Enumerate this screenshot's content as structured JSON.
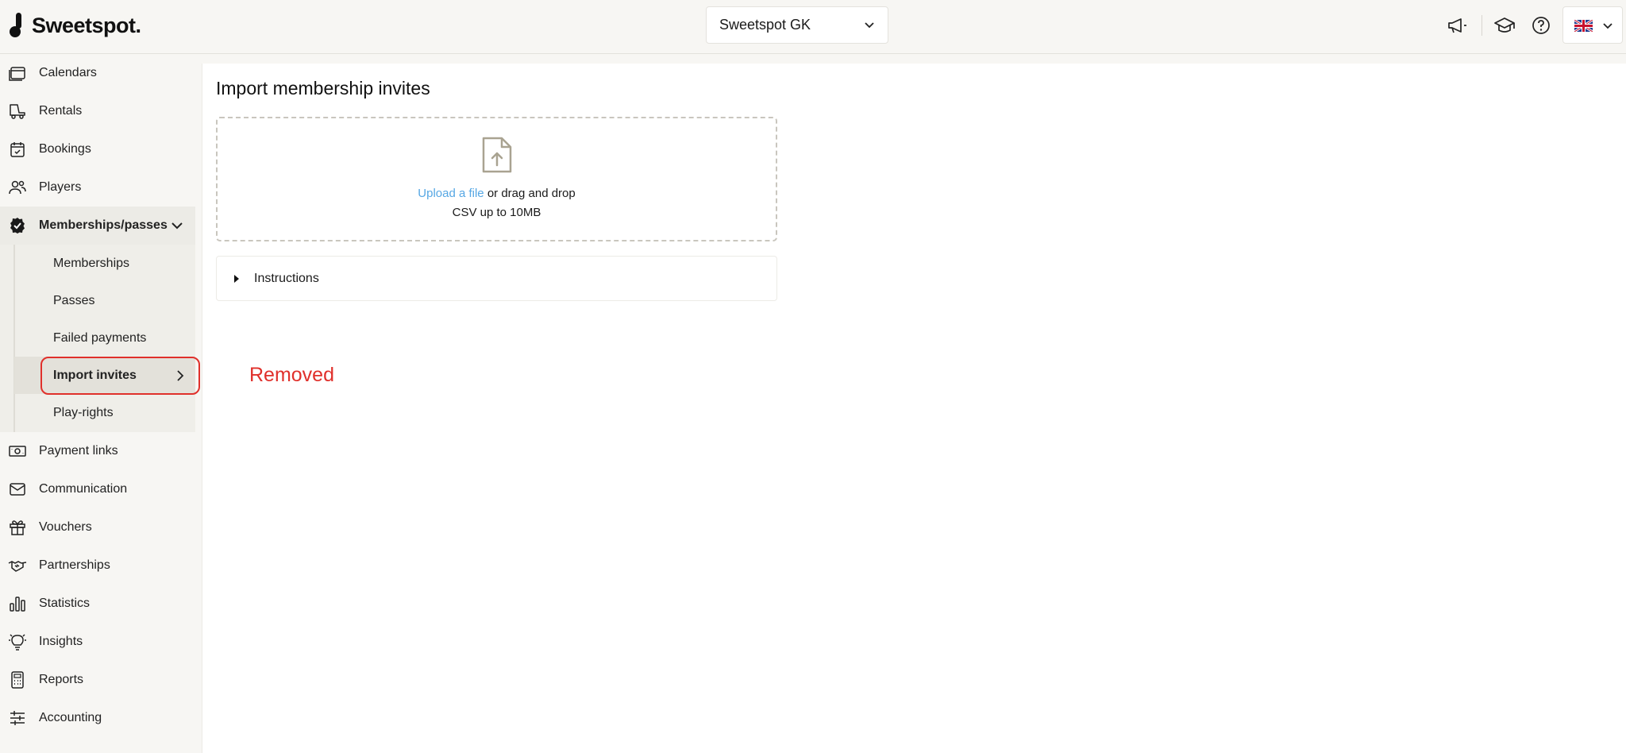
{
  "brand": {
    "name": "Sweetspot."
  },
  "header": {
    "venue": "Sweetspot GK",
    "icons": [
      "megaphone-icon",
      "graduation-cap-icon",
      "help-circle-icon"
    ],
    "language_flag": "uk-flag-icon"
  },
  "sidebar": {
    "items": [
      {
        "label": "Calendars",
        "icon": "calendar-icon"
      },
      {
        "label": "Rentals",
        "icon": "golf-cart-icon"
      },
      {
        "label": "Bookings",
        "icon": "calendar-check-icon"
      },
      {
        "label": "Players",
        "icon": "users-icon"
      },
      {
        "label": "Memberships/passes",
        "icon": "badge-check-icon",
        "expanded": true
      },
      {
        "label": "Payment links",
        "icon": "money-link-icon"
      },
      {
        "label": "Communication",
        "icon": "envelope-icon"
      },
      {
        "label": "Vouchers",
        "icon": "gift-icon"
      },
      {
        "label": "Partnerships",
        "icon": "handshake-icon"
      },
      {
        "label": "Statistics",
        "icon": "bar-chart-icon"
      },
      {
        "label": "Insights",
        "icon": "lightbulb-icon"
      },
      {
        "label": "Reports",
        "icon": "calculator-icon"
      },
      {
        "label": "Accounting",
        "icon": "sliders-icon"
      }
    ],
    "sub_items": [
      {
        "label": "Memberships"
      },
      {
        "label": "Passes"
      },
      {
        "label": "Failed payments"
      },
      {
        "label": "Import invites",
        "active": true
      },
      {
        "label": "Play-rights"
      }
    ]
  },
  "main": {
    "title": "Import membership invites",
    "upload_link": "Upload a file",
    "upload_text": " or drag and drop",
    "upload_hint": "CSV up to 10MB",
    "instructions_label": "Instructions",
    "annotation": "Removed"
  },
  "colors": {
    "accent_link": "#56a7e4",
    "highlight": "#e0302b",
    "sidebar_bg": "#f7f6f3"
  }
}
